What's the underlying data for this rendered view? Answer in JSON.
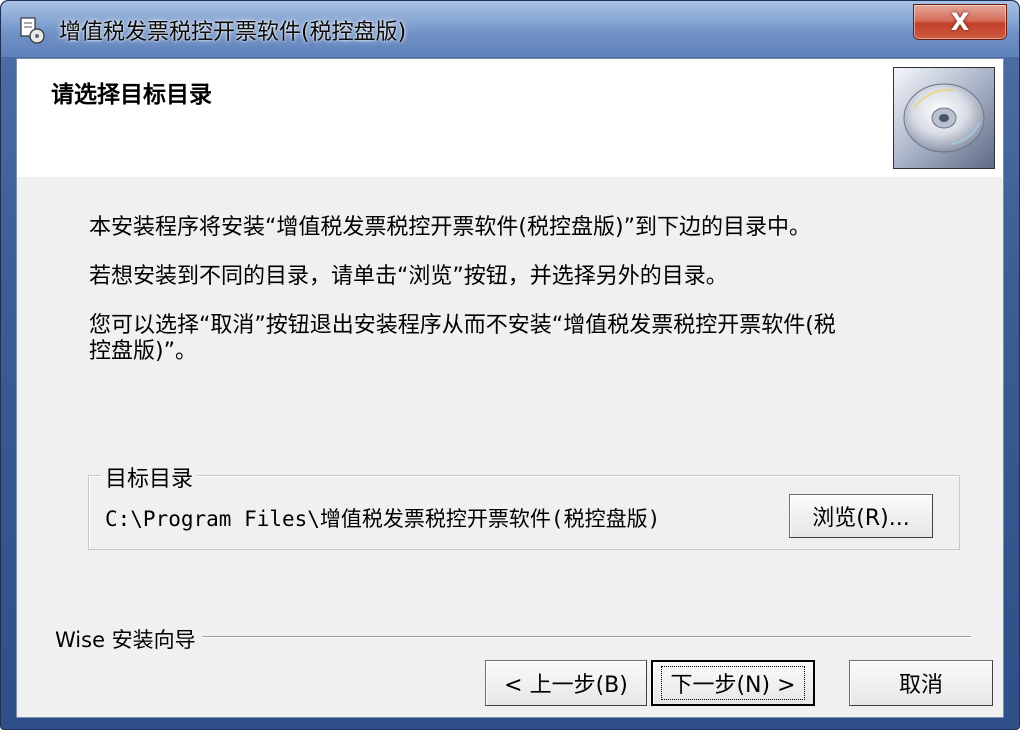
{
  "window": {
    "title": "增值税发票税控开票软件(税控盘版)",
    "close_label": "X"
  },
  "header": {
    "title": "请选择目标目录",
    "image_icon": "cd-disc-icon"
  },
  "body": {
    "line1": "本安装程序将安装“增值税发票税控开票软件(税控盘版)”到下边的目录中。",
    "line2": "若想安装到不同的目录，请单击“浏览”按钮，并选择另外的目录。",
    "line3a": "您可以选择“取消”按钮退出安装程序从而不安装“增值税发票税控开票软件(税",
    "line3b": "控盘版)”。"
  },
  "target_group": {
    "label": "目标目录",
    "path": "C:\\Program Files\\增值税发票税控开票软件(税控盘版)",
    "browse_label": "浏览(R)..."
  },
  "footer": {
    "brand": "Wise 安装向导",
    "back_label": "< 上一步(B)",
    "next_label": "下一步(N) >",
    "cancel_label": "取消"
  },
  "colors": {
    "titlebar": "#87a6d3",
    "close": "#c2412a",
    "client": "#f0f0f0"
  }
}
